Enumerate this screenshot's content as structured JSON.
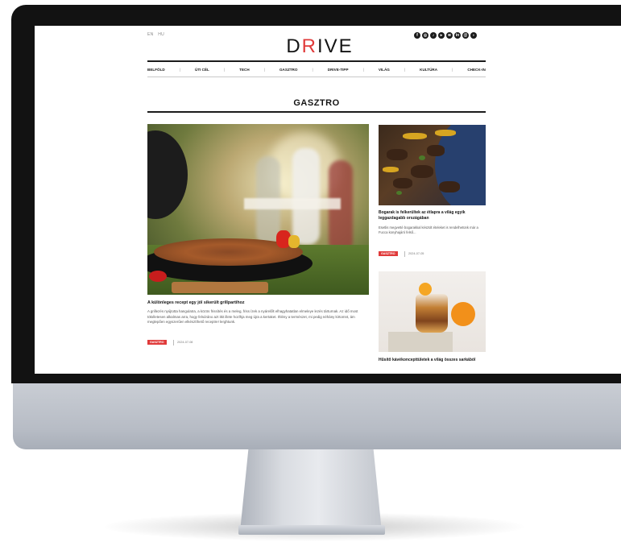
{
  "header": {
    "lang_items": [
      "EN",
      "HU"
    ],
    "logo_prefix": "D",
    "logo_accent": "R",
    "logo_suffix": "IVE",
    "social_icons": [
      "facebook-icon",
      "instagram-icon",
      "tiktok-icon",
      "youtube-icon",
      "spotify-icon",
      "linkedin-icon",
      "email-icon",
      "rss-icon"
    ]
  },
  "nav": {
    "items": [
      "BELFÖLD",
      "ÚTI CÉL",
      "TECH",
      "GASZTRO",
      "DRIVE-TIPP",
      "VILÁG",
      "KULTÚRA",
      "CHECK-IN"
    ]
  },
  "section": {
    "title": "GASZTRO"
  },
  "main_article": {
    "headline": "A különleges recept egy jól sikerült grillpartihoz",
    "excerpt": "A grillezés nyújtotta hangulatra, a közös frissítés és a meleg, friss ízek a nyárelőlt elhagyhatatlan elmeleye lezés tárturnak. Az idő most tökéletesen alkalmas arra, hogy felsóráno azt itkt illete hozlhja meg újra a kertaket. Ihlény a természet, mi pedig néhány kirtomnt, ám meglepően egyszerűen elkészíthető receptre! lerghtunk.",
    "tag": "GASZTRO",
    "date": "2024-07-08"
  },
  "side_articles": [
    {
      "headline": "Bogarak is felkerültek az étlapra a világ egyik leggazdagabb országában",
      "excerpt": "Esetlis megvetté bogarakkal készült ételeket is rendelhetünk már a Fucca konyhajáró felső...",
      "tag": "GASZTRO",
      "date": "2024-07-05"
    },
    {
      "headline": "Hűsítő kávékoncepttületek a világ összes sarkából"
    }
  ],
  "colors": {
    "accent": "#e03a3a",
    "text": "#141414",
    "bezel": "#121212"
  }
}
